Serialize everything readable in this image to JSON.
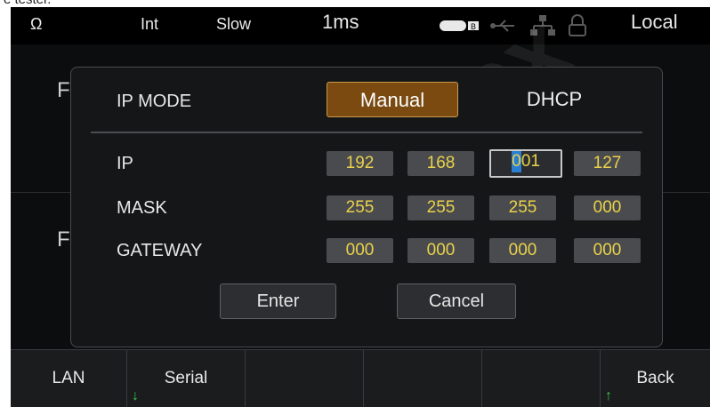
{
  "caption": "e tester.",
  "status_bar": {
    "omega": "Ω",
    "integration": "Int",
    "speed": "Slow",
    "time": "1ms",
    "mode": "Local",
    "icons": [
      "battery-icon",
      "usb-icon",
      "network-icon",
      "lock-icon"
    ]
  },
  "background": {
    "letter1": "F",
    "letter2": "F"
  },
  "dialog": {
    "ip_mode_label": "IP MODE",
    "manual_label": "Manual",
    "dhcp_label": "DHCP",
    "ip_label": "IP",
    "mask_label": "MASK",
    "gateway_label": "GATEWAY",
    "ip": {
      "o1": "192",
      "o2": "168",
      "o3_cursor": "0",
      "o3_rest": "01",
      "o4": "127"
    },
    "mask": {
      "o1": "255",
      "o2": "255",
      "o3": "255",
      "o4": "000"
    },
    "gateway": {
      "o1": "000",
      "o2": "000",
      "o3": "000",
      "o4": "000"
    },
    "enter_label": "Enter",
    "cancel_label": "Cancel"
  },
  "softkeys": {
    "lan": "LAN",
    "serial": "Serial",
    "back": "Back"
  },
  "watermark": "cynex",
  "colors": {
    "accent_active": "#7a4a10",
    "value_text": "#e9d24a",
    "cursor": "#2c7fd0",
    "arrow": "#3cc34a"
  }
}
